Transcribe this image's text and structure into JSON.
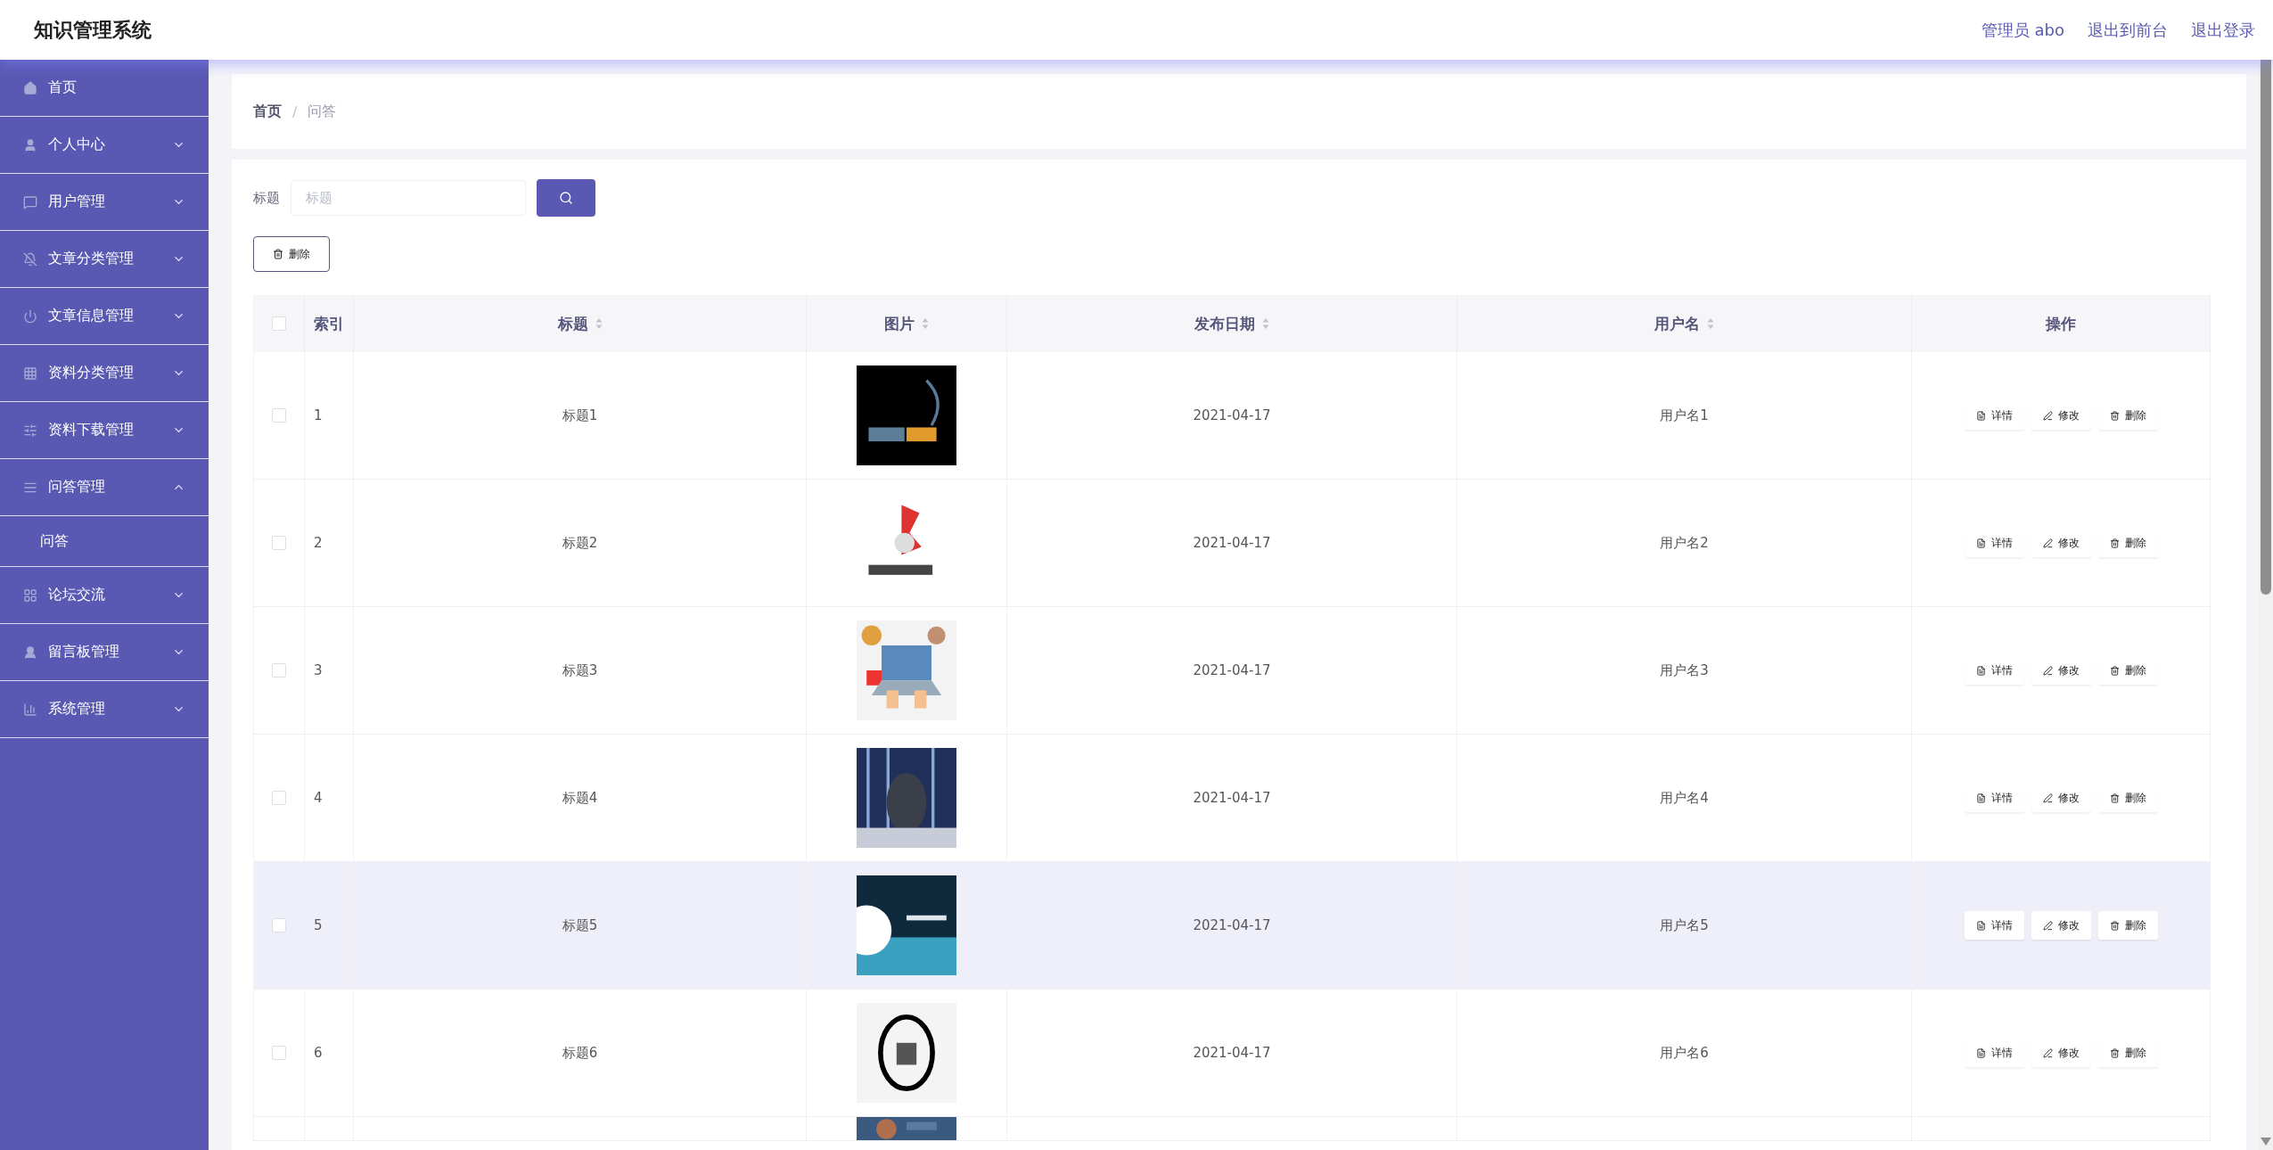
{
  "header": {
    "title": "知识管理系统",
    "links": [
      "管理员 abo",
      "退出到前台",
      "退出登录"
    ]
  },
  "sidebar": {
    "items": [
      {
        "label": "首页",
        "kind": "link"
      },
      {
        "label": "个人中心",
        "kind": "menu",
        "expanded": false
      },
      {
        "label": "用户管理",
        "kind": "menu",
        "expanded": false
      },
      {
        "label": "文章分类管理",
        "kind": "menu",
        "expanded": false
      },
      {
        "label": "文章信息管理",
        "kind": "menu",
        "expanded": false
      },
      {
        "label": "资料分类管理",
        "kind": "menu",
        "expanded": false
      },
      {
        "label": "资料下载管理",
        "kind": "menu",
        "expanded": false
      },
      {
        "label": "问答管理",
        "kind": "menu",
        "expanded": true,
        "children": [
          {
            "label": "问答"
          }
        ]
      },
      {
        "label": "论坛交流",
        "kind": "menu",
        "expanded": false
      },
      {
        "label": "留言板管理",
        "kind": "menu",
        "expanded": false
      },
      {
        "label": "系统管理",
        "kind": "menu",
        "expanded": false
      }
    ]
  },
  "breadcrumb": {
    "items": [
      "首页",
      "问答"
    ],
    "separator": "/"
  },
  "search": {
    "label": "标题",
    "placeholder": "标题"
  },
  "delete_button": "删除",
  "table": {
    "select_all_checked": false,
    "columns": [
      {
        "label": "索引",
        "sortable": false
      },
      {
        "label": "标题",
        "sortable": true
      },
      {
        "label": "图片",
        "sortable": true
      },
      {
        "label": "发布日期",
        "sortable": true
      },
      {
        "label": "用户名",
        "sortable": true
      },
      {
        "label": "操作",
        "sortable": false
      }
    ],
    "rows": [
      {
        "kind": "full",
        "index": "1",
        "title": "标题1",
        "date": "2021-04-17",
        "user": "用户名1",
        "checked": false,
        "hovered": false,
        "actions": [
          "详情",
          "修改",
          "删除"
        ]
      },
      {
        "kind": "full",
        "index": "2",
        "title": "标题2",
        "date": "2021-04-17",
        "user": "用户名2",
        "checked": false,
        "hovered": false,
        "actions": [
          "详情",
          "修改",
          "删除"
        ]
      },
      {
        "kind": "full",
        "index": "3",
        "title": "标题3",
        "date": "2021-04-17",
        "user": "用户名3",
        "checked": false,
        "hovered": false,
        "actions": [
          "详情",
          "修改",
          "删除"
        ]
      },
      {
        "kind": "full",
        "index": "4",
        "title": "标题4",
        "date": "2021-04-17",
        "user": "用户名4",
        "checked": false,
        "hovered": false,
        "actions": [
          "详情",
          "修改",
          "删除"
        ]
      },
      {
        "kind": "full",
        "index": "5",
        "title": "标题5",
        "date": "2021-04-17",
        "user": "用户名5",
        "checked": false,
        "hovered": true,
        "actions": [
          "详情",
          "修改",
          "删除"
        ]
      },
      {
        "kind": "full",
        "index": "6",
        "title": "标题6",
        "date": "2021-04-17",
        "user": "用户名6",
        "checked": false,
        "hovered": false,
        "actions": [
          "详情",
          "修改",
          "删除"
        ]
      },
      {
        "kind": "partial"
      }
    ]
  }
}
